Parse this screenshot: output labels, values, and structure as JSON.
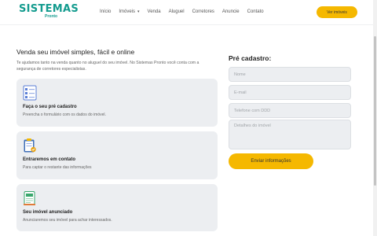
{
  "header": {
    "logo_main": "SISTEMAS",
    "logo_sub": "Pronto",
    "nav": [
      {
        "label": "Início"
      },
      {
        "label": "Imóveis"
      },
      {
        "label": "Venda"
      },
      {
        "label": "Aluguel"
      },
      {
        "label": "Corretores"
      },
      {
        "label": "Anuncie"
      },
      {
        "label": "Contato"
      }
    ],
    "nav_caret": "▾",
    "cta_label": "Ver imóveis"
  },
  "main": {
    "title": "Venda seu imóvel simples, fácil e online",
    "description": "Te ajudamos tanto na venda quanto no aluguel do seu imóvel. No Sistemas Pronto você conta com a segurança de corretores especialistas.",
    "steps": [
      {
        "title": "Faça o seu pré cadastro",
        "text": "Preencha o formulário com os dados do imóvel.",
        "icon": "checklist-icon"
      },
      {
        "title": "Entraremos em contato",
        "text": "Para captar o restante das informações",
        "icon": "clipboard-icon"
      },
      {
        "title": "Seu imóvel anunciado",
        "text": "Anunciaremos seu imóvel para achar interessados.",
        "icon": "document-icon"
      }
    ]
  },
  "form": {
    "title": "Pré cadastro:",
    "name_placeholder": "Nome",
    "email_placeholder": "E-mail",
    "phone_placeholder": "Telefone com DDD",
    "details_placeholder": "Detalhes do imóvel",
    "submit_label": "Enviar informações"
  },
  "colors": {
    "brand": "#139b8e",
    "accent": "#f5b800",
    "card_bg": "#eceef1"
  }
}
